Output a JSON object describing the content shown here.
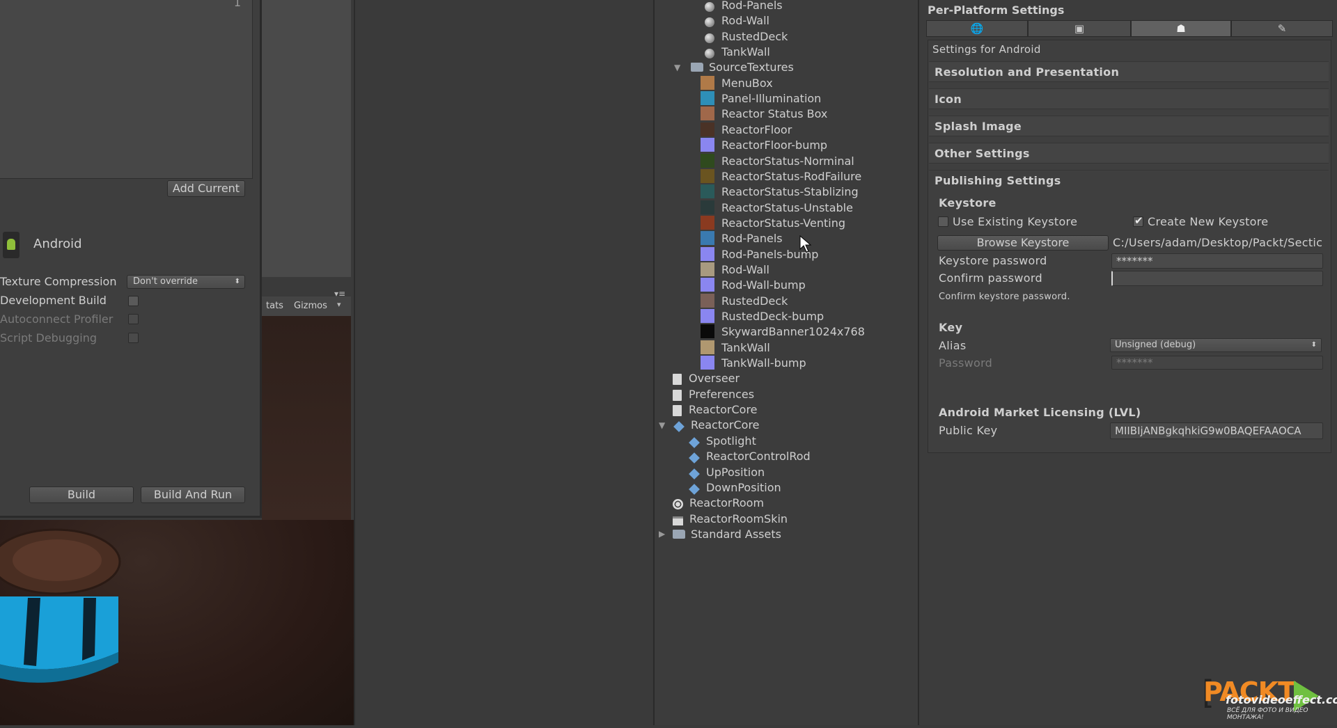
{
  "build_settings": {
    "scene_index": "1",
    "add_current": "Add Current",
    "platform": "Android",
    "texture_compression_label": "Texture Compression",
    "texture_compression_value": "Don't override",
    "development_build": "Development Build",
    "autoconnect_profiler": "Autoconnect Profiler",
    "script_debugging": "Script Debugging",
    "build": "Build",
    "build_and_run": "Build And Run"
  },
  "scene_toolbar": {
    "stats": "tats",
    "gizmos": "Gizmos"
  },
  "project_tree": {
    "items": [
      {
        "label": "Rod-Panels",
        "icon": "sphere"
      },
      {
        "label": "Rod-Wall",
        "icon": "sphere"
      },
      {
        "label": "RustedDeck",
        "icon": "sphere"
      },
      {
        "label": "TankWall",
        "icon": "sphere"
      },
      {
        "label": "SourceTextures",
        "icon": "folder"
      },
      {
        "label": "MenuBox",
        "icon": "texture",
        "color": "#b07a48"
      },
      {
        "label": "Panel-Illumination",
        "icon": "texture",
        "color": "#2e8fb8"
      },
      {
        "label": "Reactor Status Box",
        "icon": "texture",
        "color": "#a0684a"
      },
      {
        "label": "ReactorFloor",
        "icon": "texture",
        "color": "#4a3226"
      },
      {
        "label": "ReactorFloor-bump",
        "icon": "texture",
        "color": "#8a86f0"
      },
      {
        "label": "ReactorStatus-Norminal",
        "icon": "texture",
        "color": "#2f4a1e"
      },
      {
        "label": "ReactorStatus-RodFailure",
        "icon": "texture",
        "color": "#6a5420"
      },
      {
        "label": "ReactorStatus-Stablizing",
        "icon": "texture",
        "color": "#2a5a5a"
      },
      {
        "label": "ReactorStatus-Unstable",
        "icon": "texture",
        "color": "#2a3a3a"
      },
      {
        "label": "ReactorStatus-Venting",
        "icon": "texture",
        "color": "#8a3a20"
      },
      {
        "label": "Rod-Panels",
        "icon": "texture",
        "color": "#3a7ab0"
      },
      {
        "label": "Rod-Panels-bump",
        "icon": "texture",
        "color": "#8a86f0"
      },
      {
        "label": "Rod-Wall",
        "icon": "texture",
        "color": "#a89a80"
      },
      {
        "label": "Rod-Wall-bump",
        "icon": "texture",
        "color": "#8a86f0"
      },
      {
        "label": "RustedDeck",
        "icon": "texture",
        "color": "#7a6058"
      },
      {
        "label": "RustedDeck-bump",
        "icon": "texture",
        "color": "#8a86f0"
      },
      {
        "label": "SkywardBanner1024x768",
        "icon": "texture",
        "color": "#0a0a0a"
      },
      {
        "label": "TankWall",
        "icon": "texture",
        "color": "#b09870"
      },
      {
        "label": "TankWall-bump",
        "icon": "texture",
        "color": "#8a86f0"
      },
      {
        "label": "Overseer",
        "icon": "script"
      },
      {
        "label": "Preferences",
        "icon": "script"
      },
      {
        "label": "ReactorCore",
        "icon": "script"
      },
      {
        "label": "ReactorCore",
        "icon": "cube"
      },
      {
        "label": "Spotlight",
        "icon": "cube"
      },
      {
        "label": "ReactorControlRod",
        "icon": "cube"
      },
      {
        "label": "UpPosition",
        "icon": "cube"
      },
      {
        "label": "DownPosition",
        "icon": "cube"
      },
      {
        "label": "ReactorRoom",
        "icon": "scene"
      },
      {
        "label": "ReactorRoomSkin",
        "icon": "skin"
      },
      {
        "label": "Standard Assets",
        "icon": "folder"
      }
    ]
  },
  "inspector": {
    "title": "Per-Platform Settings",
    "tabs": [
      "globe-icon",
      "standalone-icon",
      "android-icon",
      "flash-icon"
    ],
    "settings_for": "Settings for Android",
    "sections": {
      "resolution": "Resolution and Presentation",
      "icon": "Icon",
      "splash": "Splash Image",
      "other": "Other Settings",
      "publishing": "Publishing Settings"
    },
    "keystore": {
      "header": "Keystore",
      "use_existing": "Use Existing Keystore",
      "create_new": "Create New Keystore",
      "browse": "Browse Keystore",
      "path": "C:/Users/adam/Desktop/Packt/Sectic",
      "password_label": "Keystore password",
      "password_value": "*******",
      "confirm_label": "Confirm password",
      "confirm_value": "",
      "hint": "Confirm keystore password."
    },
    "key": {
      "header": "Key",
      "alias_label": "Alias",
      "alias_value": "Unsigned (debug)",
      "password_label": "Password",
      "password_value": "*******"
    },
    "licensing": {
      "header": "Android Market Licensing (LVL)",
      "public_key_label": "Public Key",
      "public_key_value": "MIIBIjANBgkqhkiG9w0BAQEFAAOCA"
    }
  },
  "watermark": {
    "logo": "PACKT",
    "site": "fotovideoeffect.com",
    "sub": "ВСЁ ДЛЯ ФОТО И ВИДЕО МОНТАЖА!"
  }
}
